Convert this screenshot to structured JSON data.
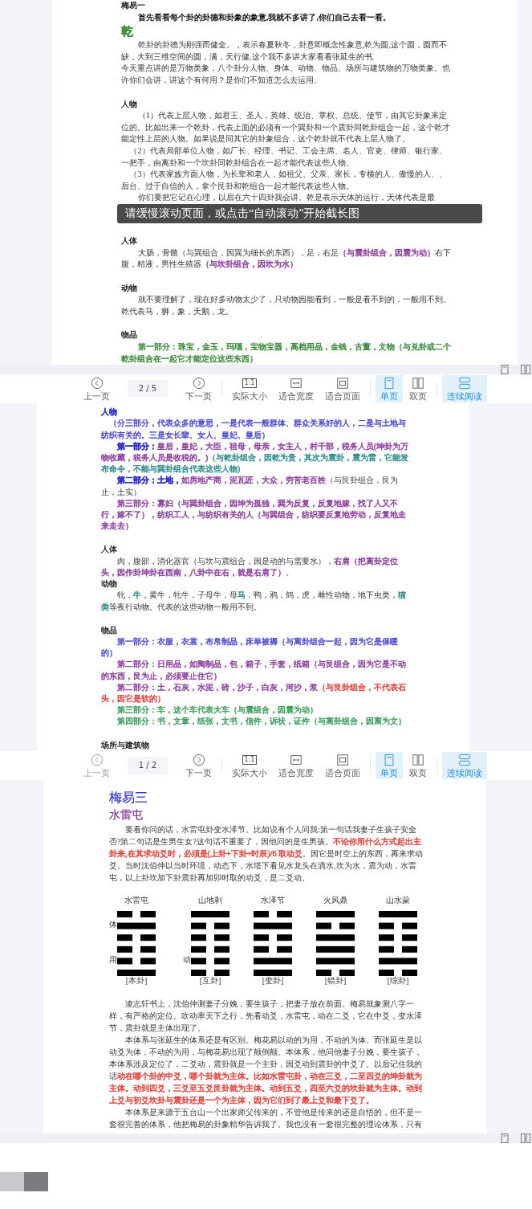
{
  "sections": [
    {
      "kind": "page",
      "blocks": [
        {
          "kind": "heading_tight",
          "runs": [
            {
              "text": "梅易一"
            }
          ]
        },
        {
          "kind": "lead",
          "runs": [
            {
              "text": "首先看看每个卦的卦德和卦象的象意,我就不多讲了,你们自己去看一看。"
            }
          ]
        },
        {
          "kind": "title",
          "runs": [
            {
              "text": "乾",
              "color": "#3a8a3a"
            }
          ]
        },
        {
          "kind": "para",
          "runs": [
            {
              "text": "乾卦的卦德为刚强而健全。，表示春夏秋冬，卦意即概念性象意,乾为圆,这个圆，圆而不缺，大到三维空间的圆，满，天行健,这个我不多讲大家看看张延生的书,"
            }
          ]
        },
        {
          "kind": "para_flush",
          "runs": [
            {
              "text": "今天重点讲的是万物类象，八个卦分人物、身体、动物、物品、场所与建筑物的万物类象。也许你们会讲，讲这个有何用？是你们不知道怎么去运用。"
            }
          ]
        },
        {
          "kind": "heading",
          "runs": [
            {
              "text": "人物"
            }
          ]
        },
        {
          "kind": "para",
          "runs": [
            {
              "text": "（1）代表上层人物，如君王、圣人，英雄、统治、掌权、总统、使节，由其它卦象来定位的。比如出来一个乾卦，代表上面的必须有一个巽卦和一个震卦同乾卦组合一起，这个乾才能定性上层的人物。如果说是同其它的卦象组合，这个乾卦就不代表上层人物了。"
            }
          ]
        },
        {
          "kind": "para_narrow",
          "runs": [
            {
              "text": "（2）代表局部单位人物，如厂长、经理、书记、工会主席、名人、官吏、律师、银行家、一把手，由离卦和一个坎卦同乾卦组合在一起才能代表这些人物。"
            }
          ]
        },
        {
          "kind": "para_narrow",
          "runs": [
            {
              "text": "（3）代表家族方面人物，为长辈和老人，如祖父、父亲、家长，专横的人、傲慢的人、、后台、过于自信的人，拿个艮卦和乾组合一起才能代表这些人物。"
            }
          ]
        },
        {
          "kind": "para",
          "runs": [
            {
              "text": "你们要把它记在心理，以后在六十四卦我会讲。乾是表示天体的运行，天体代表是最"
            }
          ]
        },
        {
          "kind": "toast",
          "text": "请缓慢滚动页面，或点击“自动滚动”开始截长图"
        },
        {
          "kind": "heading",
          "runs": [
            {
              "text": "人体"
            }
          ]
        },
        {
          "kind": "para",
          "runs": [
            {
              "text": "大肠，骨骼（与巽组合，因巽为细长的东西），足，右足"
            },
            {
              "text": "（与震卦组合，因震为动）",
              "color": "#8a3a9a"
            },
            {
              "text": "右下腹，精液，男性生殖器"
            },
            {
              "text": "（与坎卦组合，因坎为水）",
              "color": "#8a3a9a"
            }
          ]
        },
        {
          "kind": "heading",
          "runs": [
            {
              "text": "动物"
            }
          ]
        },
        {
          "kind": "para",
          "runs": [
            {
              "text": "就不要理解了，现在好多动物太少了，只动物园能看到，一般是看不到的，一般用不到。乾代表马，狮，象，天鹅，龙。"
            }
          ]
        },
        {
          "kind": "heading",
          "runs": [
            {
              "text": "物品"
            }
          ]
        },
        {
          "kind": "para",
          "runs": [
            {
              "text": "第一部分：珠宝，金玉，玛瑙，宝物宝器，高档用品，金钱，古董，文物（与兑卦或二个乾卦组合在一起它才能定位这些东西）",
              "color": "#3a8a3a"
            }
          ]
        }
      ]
    },
    {
      "kind": "strip"
    },
    {
      "kind": "toolbar",
      "prev": {
        "label": "上一页",
        "disabled": false
      },
      "page": "2 / 5",
      "next": {
        "label": "下一页",
        "disabled": false
      },
      "views": [
        {
          "label": "实际大小",
          "badge": "1:1",
          "selected": false
        },
        {
          "label": "适合宽度",
          "selected": false
        },
        {
          "label": "适合页面",
          "selected": false
        },
        {
          "label": "单页",
          "selected": true
        },
        {
          "label": "双页",
          "selected": false
        },
        {
          "label": "连续阅读",
          "selected": true
        }
      ]
    },
    {
      "kind": "page",
      "blocks": [
        {
          "kind": "heading_tight",
          "runs": [
            {
              "text": "人物",
              "color": "#3333cc"
            }
          ]
        },
        {
          "kind": "para_narrow",
          "runs": [
            {
              "text": "（分三部分，代表众多的意思，一是代表一般群体、群众关系好的人，二是与土地与纺织有关的。三是女长辈、女人、皇妃、皇后）",
              "color": "#4a4ad0"
            }
          ]
        },
        {
          "kind": "para",
          "runs": [
            {
              "text": "**第一部分：**",
              "color": "#3333cc"
            },
            {
              "text": "皇后，皇妃，大臣，祖母，母亲，女主人，村干部，税务人员(坤卦为万物收藏，税务人员是收税的。)",
              "color": "#8a3a9a"
            },
            {
              "text": "（与乾卦组合，因乾为贵，其次为震卦，震为雷，它能发布命令，不能与巽卦组合代表这些人物)",
              "color": "#2a8a8a"
            }
          ]
        },
        {
          "kind": "para",
          "runs": [
            {
              "text": "**第二部分：土地，**",
              "color": "#3333cc"
            },
            {
              "text": "如房地产商，泥瓦匠，大众，穷苦老百姓",
              "color": "#8a3a9a"
            },
            {
              "text": "（与艮卦组合，艮为止，土实）"
            }
          ]
        },
        {
          "kind": "para",
          "runs": [
            {
              "text": "第三部分：寡妇（与巽卦组合，因坤为孤独，巽为反复，反复地嫁，找了人又不行，嫁不了），纺织工人，与纺织有关的人（与巽组合，纺织要反复地劳动，反复地走来走去）",
              "color": "#8a3a9a"
            }
          ]
        },
        {
          "kind": "heading",
          "runs": [
            {
              "text": "人体"
            }
          ]
        },
        {
          "kind": "para",
          "runs": [
            {
              "text": "肉，腹部，消化器官（与坎与震组合，因是动的与需要水），"
            },
            {
              "text": "右肩（把离卦定位头，因作卦坤卦在西南，八卦中在右，就是右肩了）",
              "color": "#8a3a9a"
            },
            {
              "text": "。"
            }
          ]
        },
        {
          "kind": "heading_tight",
          "runs": [
            {
              "text": "动物"
            }
          ]
        },
        {
          "kind": "para",
          "runs": [
            {
              "text": "牝，"
            },
            {
              "text": "牛",
              "color": "#2a8a8a"
            },
            {
              "text": "，黄牛，牝牛，子母牛，母"
            },
            {
              "text": "马",
              "color": "#2a8a8a"
            },
            {
              "text": "，鸭，鸦，鸽，虎，雌性动物，地下虫类，"
            },
            {
              "text": "猫类",
              "color": "#2a8a8a"
            },
            {
              "text": "等夜行动物。代表的这些动物一般用不到。"
            }
          ]
        },
        {
          "kind": "heading",
          "runs": [
            {
              "text": "物品"
            }
          ]
        },
        {
          "kind": "para",
          "runs": [
            {
              "text": "第一部分：衣服，衣裳，布帛制品，床单被褥（与离卦组合一起，因为它是保暖的）",
              "color": "#4a4ad0"
            }
          ]
        },
        {
          "kind": "para",
          "runs": [
            {
              "text": "第二部分：日用品，如陶制品，包，箱子，手套，纸箱（与艮组合，因为它是不动的东西，艮为止，必须要止住它）",
              "color": "#8a3a9a"
            }
          ]
        },
        {
          "kind": "para",
          "runs": [
            {
              "text": "第二部分：土，石灰，水泥，砖，沙子，白灰，河沙，浆",
              "color": "#8a3a9a"
            },
            {
              "text": "（与艮卦组合，不代表石头，因它是软的）",
              "color": "#e0403a"
            }
          ]
        },
        {
          "kind": "para",
          "runs": [
            {
              "text": "第三部分：车，这个车代表大车（与震组合，因震为动）",
              "color": "#3a9a5a"
            }
          ]
        },
        {
          "kind": "para",
          "runs": [
            {
              "text": "第四部分：书，文章，纸张，文书，信件，诉状，证件（与离卦组合，因离为文）",
              "color": "#3a9a5a"
            }
          ]
        },
        {
          "kind": "heading",
          "runs": [
            {
              "text": "场所与建筑物"
            }
          ]
        }
      ]
    },
    {
      "kind": "toolbar",
      "prev": {
        "label": "上一页",
        "disabled": true
      },
      "page": "1 / 2",
      "next": {
        "label": "下一页",
        "disabled": false
      },
      "views": [
        {
          "label": "实际大小",
          "badge": "1:1",
          "selected": false
        },
        {
          "label": "适合宽度",
          "selected": false
        },
        {
          "label": "适合页面",
          "selected": false
        },
        {
          "label": "单页",
          "selected": true
        },
        {
          "label": "双页",
          "selected": false
        },
        {
          "label": "连续阅读",
          "selected": true
        }
      ]
    },
    {
      "kind": "page",
      "blocks": [
        {
          "kind": "bigtitle",
          "runs": [
            {
              "text": "梅易三",
              "color": "#3333cc"
            }
          ]
        },
        {
          "kind": "title",
          "runs": [
            {
              "text": "水雷屯",
              "color": "#7a2a8a"
            }
          ]
        },
        {
          "kind": "para",
          "runs": [
            {
              "text": "要看你问的话，水雷屯卦变水泽节。比如说有个人问我:第一句话我妻子生孩子安全否?第二句话是生男生女?这句话不重要了，因他问的是生男孩。"
            },
            {
              "text": "不论你用什么方式起出主卦来,在其求动爻时，必须是(上卦+下卦+时辰)/6 取动爻",
              "color": "#e0403a"
            },
            {
              "text": "。因它是时空上的东西，再来求动爻。当时沈伯仲以当时环境，动态下，水塔下看见水龙头在滴水,坎为水，震为动，水雷屯，以上卦坎加下卦震卦再加卯时取的动爻，是二爻动。"
            }
          ]
        },
        {
          "kind": "hexagrams",
          "upper": "体",
          "lower": "用",
          "moving": "动",
          "items": [
            {
              "name": "水雷屯",
              "lines": [
                {
                  "kind": "yin"
                },
                {
                  "kind": "yang"
                },
                {
                  "kind": "yin"
                },
                {
                  "kind": "yin"
                },
                {
                  "kind": "yin"
                },
                {
                  "kind": "yang"
                }
              ],
              "label": "[本卦]"
            },
            {
              "name": "山地剥",
              "lines": [
                {
                  "kind": "yang"
                },
                {
                  "kind": "yin"
                },
                {
                  "kind": "yin"
                },
                {
                  "kind": "yin"
                },
                {
                  "kind": "yin"
                },
                {
                  "kind": "yin"
                }
              ],
              "label": "[互卦]"
            },
            {
              "name": "水泽节",
              "lines": [
                {
                  "kind": "yin"
                },
                {
                  "kind": "yang"
                },
                {
                  "kind": "yin"
                },
                {
                  "kind": "yin"
                },
                {
                  "kind": "yang"
                },
                {
                  "kind": "yang"
                }
              ],
              "label": "[变卦]"
            },
            {
              "name": "火风鼎",
              "lines": [
                {
                  "kind": "yang"
                },
                {
                  "kind": "yin"
                },
                {
                  "kind": "yang"
                },
                {
                  "kind": "yang"
                },
                {
                  "kind": "yang"
                },
                {
                  "kind": "yin"
                }
              ],
              "label": "[错卦]"
            },
            {
              "name": "山水蒙",
              "lines": [
                {
                  "kind": "yang"
                },
                {
                  "kind": "yin"
                },
                {
                  "kind": "yin"
                },
                {
                  "kind": "yin"
                },
                {
                  "kind": "yang"
                },
                {
                  "kind": "yin"
                }
              ],
              "label": "[综卦]"
            }
          ]
        },
        {
          "kind": "para",
          "runs": [
            {
              "text": "凌志轩书上，沈伯仲测妻子分娩，要生孩子，把妻子放在前面。梅易就象测八字一样，有严格的定位。吹动率天下之行，先看动爻，水雷屯，动在二爻，它在中爻，变水泽节，震卦就是主体出现了。"
            }
          ]
        },
        {
          "kind": "para",
          "runs": [
            {
              "text": "本体系与张延生的体系还是有区别。梅花易以动的为用，不动的为体。而张延生是以动爻为体，不动的为用，与梅花易出现了颠倒颠。本体系，他问他妻子分娩，要生孩子，本体系涉及定位了，二爻动，震卦就是一个主卦，因爻动到震卦的中爻了。以后记住我的话"
            },
            {
              "text": "动在哪个卦的中爻，哪个卦就为主体。比如水雷屯卦，动在三爻，二至四爻的坤卦就为主体。动到四爻，三爻至五爻艮卦就为主体。动到五爻，四至六爻的坎卦就为主体。动到上爻与初爻坎卦与震卦还是一个为主体，因为它们到了最上爻和最下爻了。",
              "color": "#e0403a"
            }
          ]
        },
        {
          "kind": "para",
          "runs": [
            {
              "text": "本体系是来源于五台山一个出家师父传来的，不管他是传来的还是自悟的，但不是一套很完善的体系，他把梅易的卦象精华告诉我了。我也没有一套很完整的理论体系，只有"
            }
          ]
        }
      ]
    },
    {
      "kind": "strip"
    },
    {
      "kind": "tail"
    }
  ]
}
